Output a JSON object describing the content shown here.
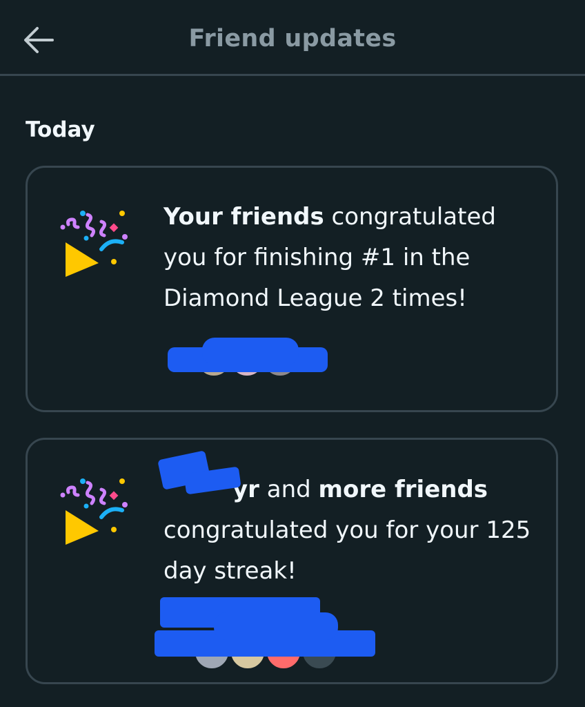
{
  "header": {
    "title": "Friend updates",
    "back_icon": "arrow-left-icon"
  },
  "section": {
    "label": "Today"
  },
  "updates": [
    {
      "icon": "party-popper-icon",
      "bold_lead": "Your friends",
      "text": " congratulated you for finishing #1 in the Diamond League 2 times!"
    },
    {
      "icon": "party-popper-icon",
      "name_fragment": "yr",
      "connector": " and ",
      "bold_more": "more friends",
      "text": " congratulated you for your 125 day streak!"
    }
  ],
  "colors": {
    "background": "#131f24",
    "border": "#37464f",
    "title_gray": "#8a9aa3",
    "text": "#f1f7fb",
    "redaction": "#1d5cf2"
  }
}
